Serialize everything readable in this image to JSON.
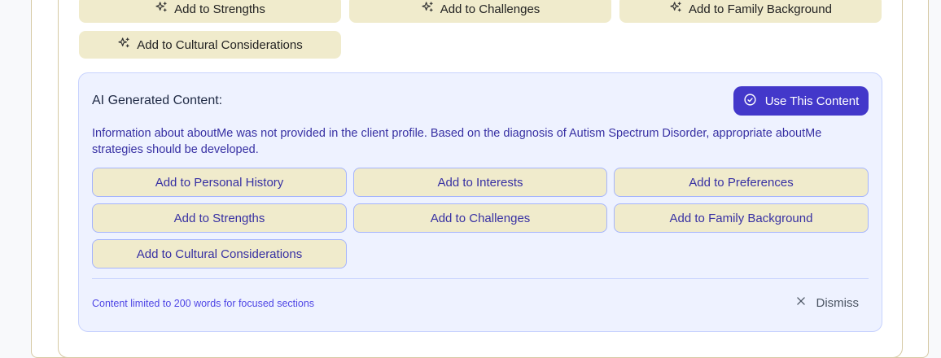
{
  "top_buttons": {
    "strengths": "Add to Strengths",
    "challenges": "Add to Challenges",
    "family_background": "Add to Family Background",
    "cultural_considerations": "Add to Cultural Considerations",
    "icon": "sparkles-icon"
  },
  "ai_panel": {
    "title": "AI Generated Content:",
    "use_button": "Use This Content",
    "use_icon": "check-circle-icon",
    "text": "Information about aboutMe was not provided in the client profile. Based on the diagnosis of Autism Spectrum Disorder, appropriate aboutMe strategies should be developed.",
    "buttons": {
      "personal_history": "Add to Personal History",
      "interests": "Add to Interests",
      "preferences": "Add to Preferences",
      "strengths": "Add to Strengths",
      "challenges": "Add to Challenges",
      "family_background": "Add to Family Background",
      "cultural_considerations": "Add to Cultural Considerations"
    },
    "footer_note": "Content limited to 200 words for focused sections",
    "dismiss_label": "Dismiss",
    "dismiss_icon": "close-icon"
  },
  "colors": {
    "accent": "#4338ca",
    "button_bg": "#f0ebcc",
    "panel_bg": "#eef2ff",
    "panel_text": "#3730a3"
  }
}
